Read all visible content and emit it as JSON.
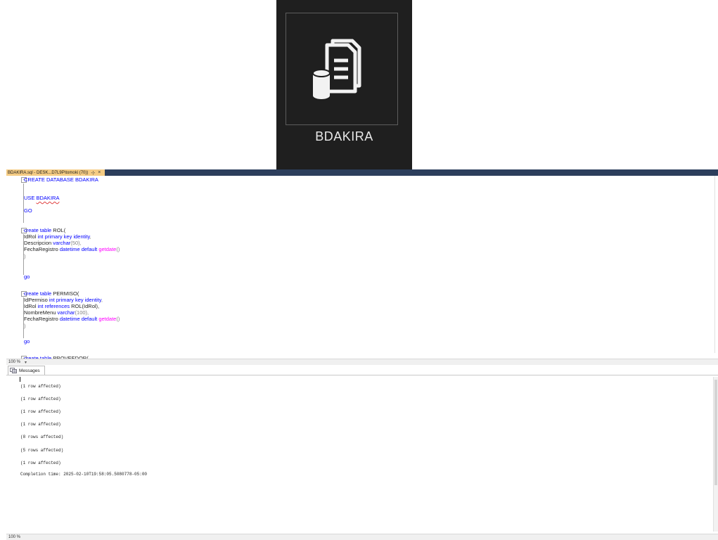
{
  "database_tile": {
    "icon": "database-document-icon",
    "label": "BDAKIRA"
  },
  "editor": {
    "tab_title": "BDAKIRA.sql - DESK...D7L9P\\tomoki (70))",
    "tab_pin": "⊹",
    "tab_close": "×",
    "code": {
      "l1_kw": "CREATE DATABASE",
      "l1_name": " BDAKIRA",
      "l2_kw": "USE",
      "l2_name": "BDAKIRA",
      "l3_go": "GO",
      "rol_kw": "create table",
      "rol_name": " ROL(",
      "rol_c1_name": "IdRol ",
      "rol_c1_type": "int primary key identity",
      "rol_c1_end": ",",
      "rol_c2_name": "Descripcion ",
      "rol_c2_type": "varchar",
      "rol_c2_end": "(50),",
      "rol_c3_name": "FechaRegistro ",
      "rol_c3_type": "datetime default ",
      "rol_c3_fn": "getdate",
      "rol_c3_end": "()",
      "rol_close": ")",
      "go1": "go",
      "perm_kw": "create table",
      "perm_name": " PERMISO(",
      "perm_c1_name": "IdPermiso ",
      "perm_c1_type": "int primary key identity",
      "perm_c1_end": ",",
      "perm_c2_name": "IdRol ",
      "perm_c2_type": "int references",
      "perm_c2_end": " ROL(IdRol),",
      "perm_c3_name": "NombreMenu ",
      "perm_c3_type": "varchar",
      "perm_c3_end": "(100),",
      "perm_c4_name": "FechaRegistro ",
      "perm_c4_type": "datetime default ",
      "perm_c4_fn": "getdate",
      "perm_c4_end": "()",
      "perm_close": ")",
      "go2": "go",
      "prov_kw": "create table",
      "prov_name": " PROVEEDOR("
    },
    "zoom": "100 %",
    "zoom_arrow": "▾",
    "results_tab_label": "Messages",
    "messages": [
      "(1 row affected)",
      "(1 row affected)",
      "(1 row affected)",
      "(1 row affected)",
      "(8 rows affected)",
      "(5 rows affected)",
      "(1 row affected)",
      "Completion time: 2025-02-10T19:58:05.5080778-05:00"
    ],
    "bottom_zoom": "100 %"
  },
  "colors": {
    "keyword": "#0000ff",
    "function": "#ff00ff",
    "tab_active": "#f5cc84",
    "tab_strip": "#2c3e5c",
    "tile_bg": "#1f1f1f"
  }
}
